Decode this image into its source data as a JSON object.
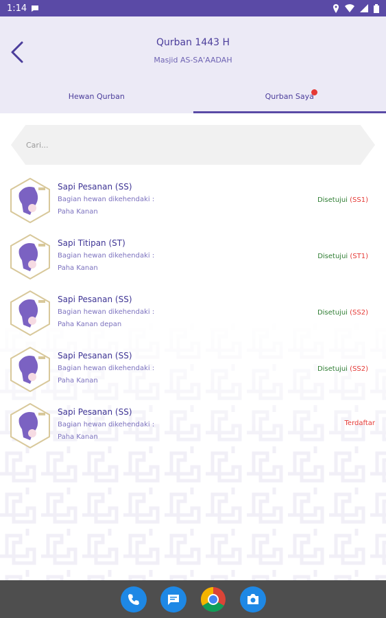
{
  "status_bar": {
    "time": "1:14"
  },
  "header": {
    "title": "Qurban 1443 H",
    "subtitle": "Masjid AS-SA'AADAH"
  },
  "tabs": [
    {
      "label": "Hewan Qurban"
    },
    {
      "label": "Qurban Saya"
    }
  ],
  "search": {
    "placeholder": "Cari..."
  },
  "items": [
    {
      "name": "Sapi Pesanan (SS)",
      "desc_label": "Bagian hewan dikehendaki :",
      "desc_value": "Paha Kanan",
      "status": "Disetujui",
      "code": "(SS1)"
    },
    {
      "name": "Sapi Titipan (ST)",
      "desc_label": "Bagian hewan dikehendaki :",
      "desc_value": "Paha Kanan",
      "status": "Disetujui",
      "code": "(ST1)"
    },
    {
      "name": "Sapi Pesanan (SS)",
      "desc_label": "Bagian hewan dikehendaki :",
      "desc_value": "Paha Kanan depan",
      "status": "Disetujui",
      "code": "(SS2)"
    },
    {
      "name": "Sapi Pesanan (SS)",
      "desc_label": "Bagian hewan dikehendaki :",
      "desc_value": "Paha Kanan",
      "status": "Disetujui",
      "code": "(SS2)"
    },
    {
      "name": "Sapi Pesanan (SS)",
      "desc_label": "Bagian hewan dikehendaki :",
      "desc_value": "Paha Kanan",
      "status": "Terdaftar",
      "code": ""
    }
  ],
  "colors": {
    "primary": "#5a4aa6",
    "header_bg": "#eceaf6",
    "approved": "#2e7d32",
    "code": "#e53935"
  },
  "nav_apps": [
    "phone-icon",
    "messages-icon",
    "chrome-icon",
    "camera-icon"
  ]
}
